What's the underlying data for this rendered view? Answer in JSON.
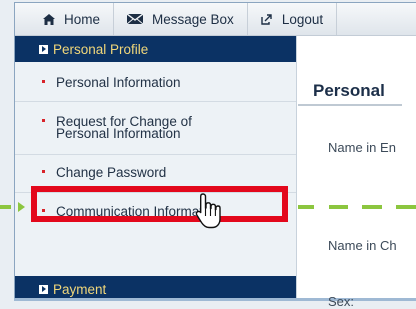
{
  "topnav": {
    "home_label": "Home",
    "message_box_label": "Message Box",
    "logout_label": "Logout"
  },
  "sidebar": {
    "section_personal": "Personal Profile",
    "items": [
      {
        "label": "Personal Information"
      },
      {
        "label_line1": "Request for Change of",
        "label_line2": "Personal Information"
      },
      {
        "label": "Change Password"
      },
      {
        "label": "Communication Information"
      }
    ],
    "section_payment": "Payment"
  },
  "content": {
    "title": "Personal",
    "field_name_en": "Name in En",
    "field_name_ch": "Name in Ch",
    "field_sex": "Sex:"
  },
  "colors": {
    "nav_dark": "#0b3264",
    "section_text": "#f1d77a",
    "highlight_red": "#e3081c",
    "arrow_green": "#8cc63f",
    "bullet_red": "#d8232a"
  },
  "icons": [
    "home-icon",
    "envelope-icon",
    "logout-icon",
    "pointer-hand-icon"
  ]
}
